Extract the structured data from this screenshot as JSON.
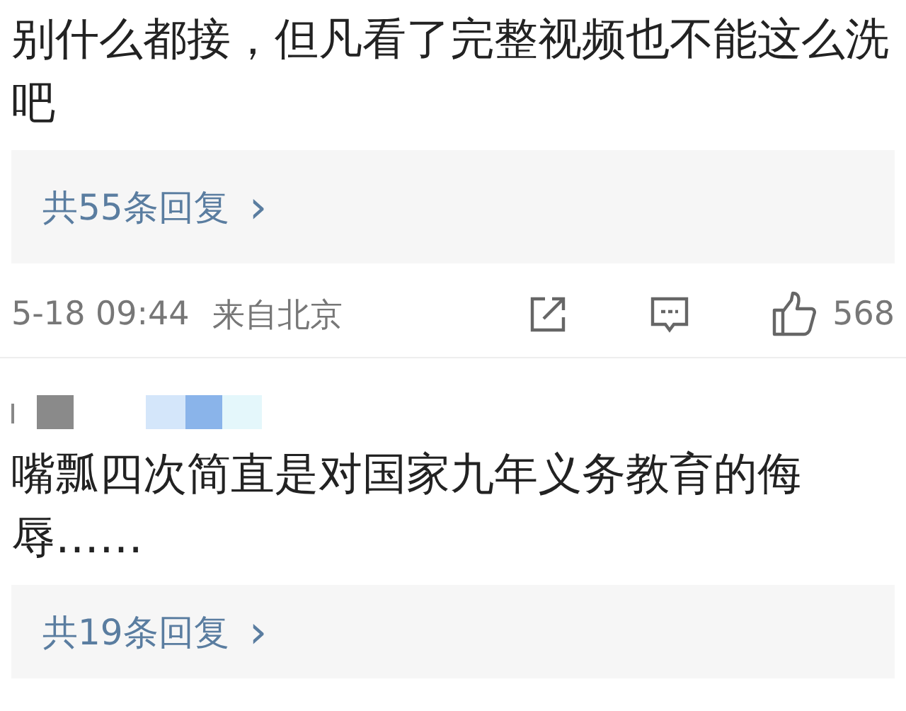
{
  "comments": [
    {
      "text": "别什么都接，但凡看了完整视频也不能这么洗吧",
      "replies": "共55条回复",
      "chevron": "›",
      "meta": {
        "time": "5-18 09:44",
        "location": "来自北京",
        "likes": "568"
      }
    },
    {
      "text": "嘴瓢四次简直是对国家九年义务教育的侮辱……",
      "replies": "共19条回复",
      "chevron": "›"
    }
  ]
}
